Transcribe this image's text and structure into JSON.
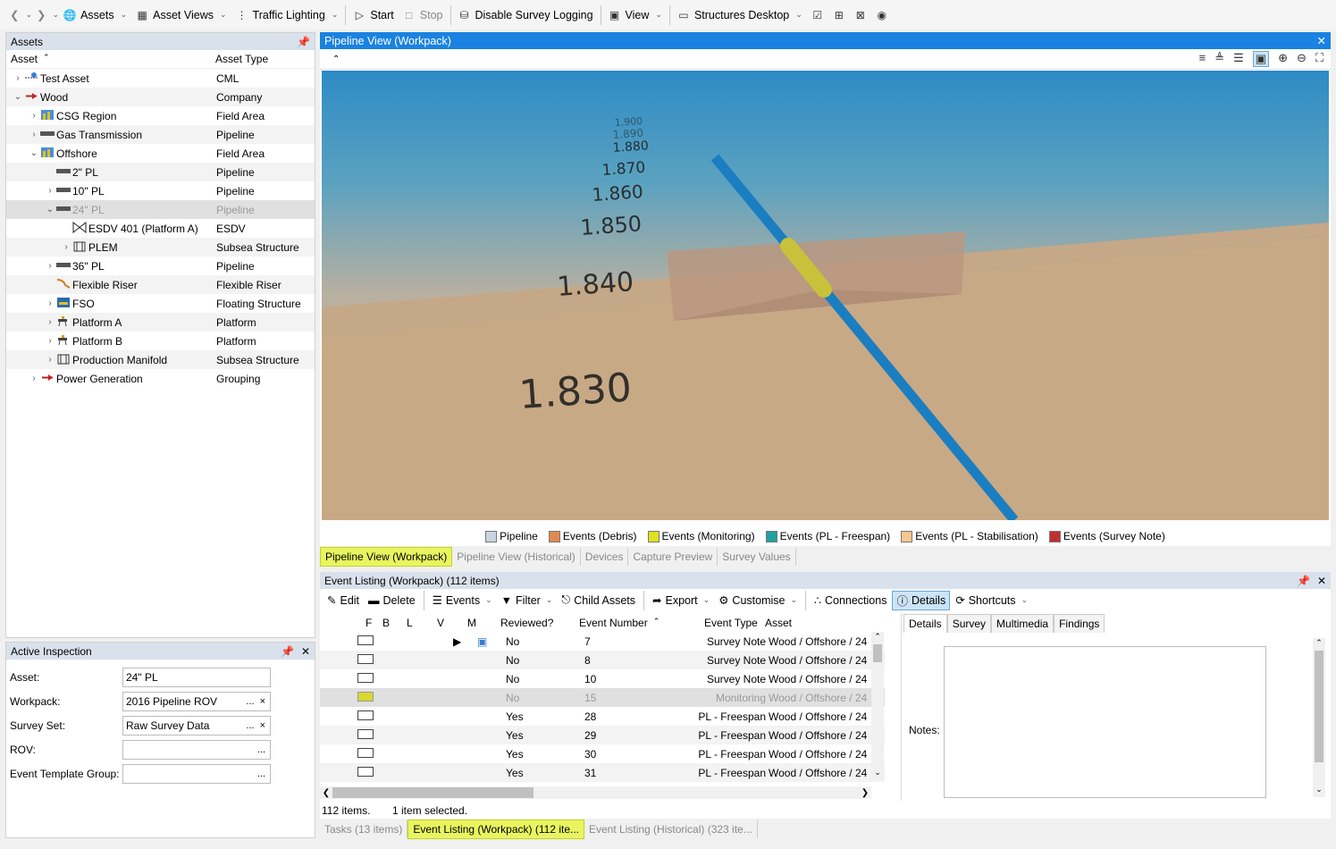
{
  "toolbar": {
    "assets": "Assets",
    "asset_views": "Asset Views",
    "traffic_lighting": "Traffic Lighting",
    "start": "Start",
    "stop": "Stop",
    "disable_survey_logging": "Disable Survey Logging",
    "view": "View",
    "structures_desktop": "Structures Desktop"
  },
  "assets_panel": {
    "title": "Assets",
    "col_asset": "Asset",
    "col_type": "Asset Type",
    "rows": [
      {
        "name": "Test Asset",
        "type": "CML"
      },
      {
        "name": "Wood",
        "type": "Company"
      },
      {
        "name": "CSG Region",
        "type": "Field Area"
      },
      {
        "name": "Gas Transmission",
        "type": "Pipeline"
      },
      {
        "name": "Offshore",
        "type": "Field Area"
      },
      {
        "name": "2\" PL",
        "type": "Pipeline"
      },
      {
        "name": "10\" PL",
        "type": "Pipeline"
      },
      {
        "name": "24\" PL",
        "type": "Pipeline"
      },
      {
        "name": "ESDV 401 (Platform A)",
        "type": "ESDV"
      },
      {
        "name": "PLEM",
        "type": "Subsea Structure"
      },
      {
        "name": "36\" PL",
        "type": "Pipeline"
      },
      {
        "name": "Flexible Riser",
        "type": "Flexible Riser"
      },
      {
        "name": "FSO",
        "type": "Floating Structure"
      },
      {
        "name": "Platform A",
        "type": "Platform"
      },
      {
        "name": "Platform B",
        "type": "Platform"
      },
      {
        "name": "Production Manifold",
        "type": "Subsea Structure"
      },
      {
        "name": "Power Generation",
        "type": "Grouping"
      }
    ]
  },
  "inspection": {
    "title": "Active Inspection",
    "asset_label": "Asset:",
    "asset_value": "24\" PL",
    "workpack_label": "Workpack:",
    "workpack_value": "2016 Pipeline ROV",
    "survey_label": "Survey Set:",
    "survey_value": "Raw Survey Data",
    "rov_label": "ROV:",
    "rov_value": "",
    "etg_label": "Event Template Group:",
    "etg_value": "",
    "ellipsis": "...",
    "clear": "×"
  },
  "view_panel": {
    "title": "Pipeline View (Workpack)",
    "kp_labels": [
      "1.900",
      "1.890",
      "1.880",
      "1.870",
      "1.860",
      "1.850",
      "1.840",
      "1.830"
    ],
    "legend": [
      {
        "label": "Pipeline",
        "color": "#c8d4e0"
      },
      {
        "label": "Events (Debris)",
        "color": "#e08a50"
      },
      {
        "label": "Events (Monitoring)",
        "color": "#e0e020"
      },
      {
        "label": "Events (PL - Freespan)",
        "color": "#20a0a0"
      },
      {
        "label": "Events (PL - Stabilisation)",
        "color": "#f5c890"
      },
      {
        "label": "Events (Survey Note)",
        "color": "#c03030"
      }
    ],
    "tabs": [
      "Pipeline View (Workpack)",
      "Pipeline View (Historical)",
      "Devices",
      "Capture Preview",
      "Survey Values"
    ]
  },
  "events": {
    "title": "Event Listing (Workpack) (112 items)",
    "toolbar": {
      "edit": "Edit",
      "delete": "Delete",
      "events": "Events",
      "filter": "Filter",
      "child_assets": "Child Assets",
      "export": "Export",
      "customise": "Customise",
      "connections": "Connections",
      "details": "Details",
      "shortcuts": "Shortcuts"
    },
    "columns": {
      "f": "F",
      "b": "B",
      "l": "L",
      "v": "V",
      "m": "M",
      "reviewed": "Reviewed?",
      "number": "Event Number",
      "type": "Event Type",
      "asset": "Asset"
    },
    "rows": [
      {
        "reviewed": "No",
        "number": "7",
        "type": "Survey Note",
        "asset": "Wood / Offshore / 24"
      },
      {
        "reviewed": "No",
        "number": "8",
        "type": "Survey Note",
        "asset": "Wood / Offshore / 24"
      },
      {
        "reviewed": "No",
        "number": "10",
        "type": "Survey Note",
        "asset": "Wood / Offshore / 24"
      },
      {
        "reviewed": "No",
        "number": "15",
        "type": "Monitoring",
        "asset": "Wood / Offshore / 24"
      },
      {
        "reviewed": "Yes",
        "number": "28",
        "type": "PL - Freespan",
        "asset": "Wood / Offshore / 24"
      },
      {
        "reviewed": "Yes",
        "number": "29",
        "type": "PL - Freespan",
        "asset": "Wood / Offshore / 24"
      },
      {
        "reviewed": "Yes",
        "number": "30",
        "type": "PL - Freespan",
        "asset": "Wood / Offshore / 24"
      },
      {
        "reviewed": "Yes",
        "number": "31",
        "type": "PL - Freespan",
        "asset": "Wood / Offshore / 24"
      }
    ],
    "detail_tabs": [
      "Details",
      "Survey",
      "Multimedia",
      "Findings"
    ],
    "notes_label": "Notes:",
    "status_items": "112 items.",
    "status_selected": "1 item selected."
  },
  "bottom_tabs": [
    "Tasks (13 items)",
    "Event Listing (Workpack) (112 ite...",
    "Event Listing (Historical) (323 ite..."
  ]
}
